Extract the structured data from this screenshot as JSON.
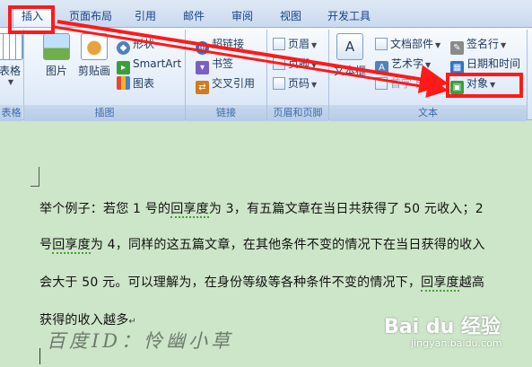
{
  "tabs": [
    {
      "label": "插入",
      "active": true
    },
    {
      "label": "页面布局"
    },
    {
      "label": "引用"
    },
    {
      "label": "邮件"
    },
    {
      "label": "审阅"
    },
    {
      "label": "视图"
    },
    {
      "label": "开发工具"
    }
  ],
  "ribbon": {
    "groups": {
      "table": {
        "label": "表格",
        "button": "表格"
      },
      "illustrations": {
        "label": "插图",
        "picture": "图片",
        "clipart": "剪贴画",
        "shapes": "形状",
        "smartart": "SmartArt",
        "chart": "图表"
      },
      "links": {
        "label": "链接",
        "hyperlink": "超链接",
        "bookmark": "书签",
        "crossref": "交叉引用"
      },
      "header_footer": {
        "label": "页眉和页脚",
        "header": "页眉",
        "footer": "页脚",
        "page_number": "页码"
      },
      "text": {
        "label": "文本",
        "textbox": "文本框",
        "quickparts": "文档部件",
        "wordart": "艺术字",
        "dropcap": "首字下沉",
        "signature": "签名行",
        "datetime": "日期和时间",
        "object": "对象"
      }
    }
  },
  "document": {
    "lines": [
      {
        "pre": "举个例子：若您 1 号的",
        "squig": "回享度",
        "post": "为 3，有五篇文章在当日共获得了 50 元收入；2"
      },
      {
        "pre": "号",
        "squig": "回享度",
        "post": "为 4，同样的这五篇文章，在其他条件不变的情况下在当日获得的收入"
      },
      {
        "pre": "会大于 50 元。可以理解为，在身份等级等各种条件不变的情况下，",
        "squig": "回享度",
        "post": "越高"
      },
      {
        "pre": "获得的收入越多",
        "squig": "",
        "post": ""
      }
    ],
    "paragraph_mark": "↵",
    "signature": "百度ID：怜幽小草"
  },
  "watermark": {
    "brand": "Bai du 经验",
    "url": "jingyan.baidu.com"
  },
  "colors": {
    "annotation": "#ff1a1a",
    "document_bg": "#cde5c8",
    "ribbon_text": "#15428b"
  }
}
